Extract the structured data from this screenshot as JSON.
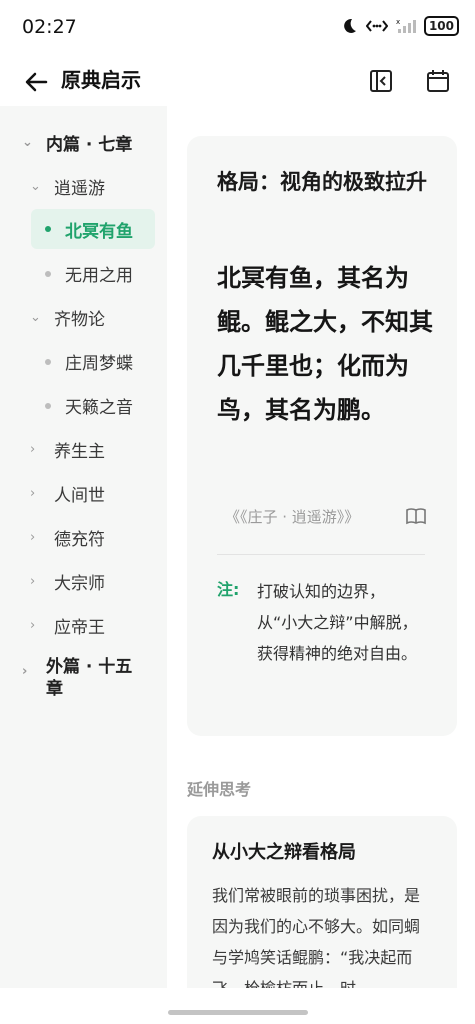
{
  "status": {
    "time": "02:27",
    "battery": "100"
  },
  "appbar": {
    "title": "原典启示"
  },
  "sidebar": {
    "items": [
      {
        "label": "内篇 · 七章"
      },
      {
        "label": "逍遥游"
      },
      {
        "label": "北冥有鱼"
      },
      {
        "label": "无用之用"
      },
      {
        "label": "齐物论"
      },
      {
        "label": "庄周梦蝶"
      },
      {
        "label": "天籁之音"
      },
      {
        "label": "养生主"
      },
      {
        "label": "人间世"
      },
      {
        "label": "德充符"
      },
      {
        "label": "大宗师"
      },
      {
        "label": "应帝王"
      },
      {
        "label": "外篇 · 十五章"
      }
    ]
  },
  "card": {
    "title": "格局：视角的极致拉升",
    "quote": "北冥有鱼，其名为鲲。鲲之大，不知其几千里也；化而为鸟，其名为鹏。",
    "source": "《《庄子 · 逍遥游》》",
    "note_label": "注:",
    "note_text": "打破认知的边界，从“小大之辩”中解脱，获得精神的绝对自由。"
  },
  "section": {
    "title": "延伸思考"
  },
  "card2": {
    "title": "从小大之辩看格局",
    "text": "我们常被眼前的琐事困扰，是因为我们的心不够大。如同蜩与学鸠笑话鲲鹏：“我决起而飞，枪榆枋而止，时"
  },
  "colors": {
    "accent": "#20a36c",
    "sidebar_bg": "#f6f7f6",
    "active_bg": "#e4f3ec"
  }
}
